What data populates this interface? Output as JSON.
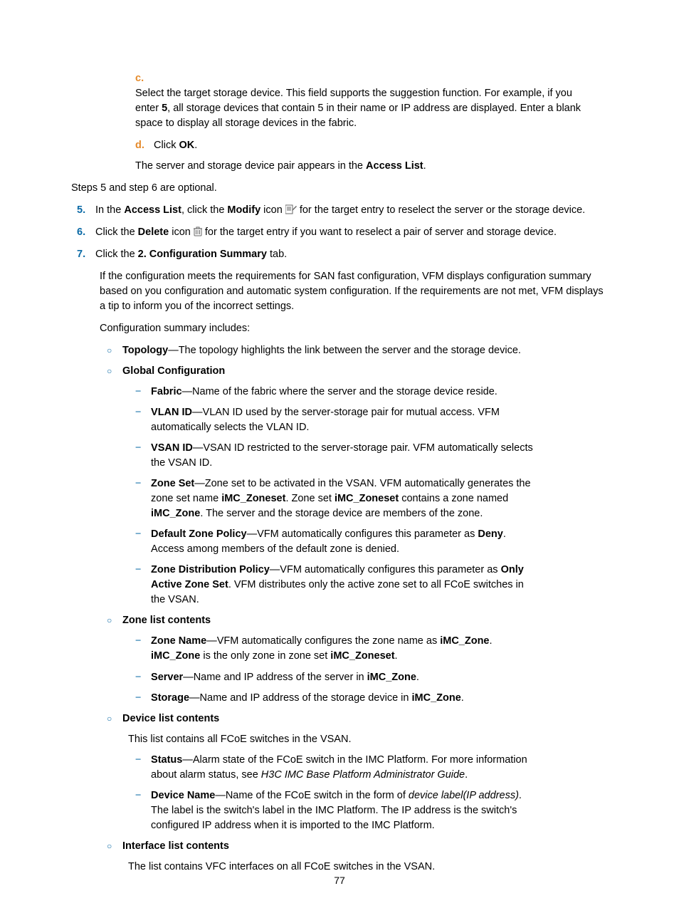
{
  "step_c_marker": "c.",
  "step_c_text_1": "Select the target storage device. This field supports the suggestion function. For example, if you enter ",
  "step_c_bold_5": "5",
  "step_c_text_2": ", all storage devices that contain 5 in their name or IP address are displayed. Enter a blank space to display all storage devices in the fabric.",
  "step_d_marker": "d.",
  "step_d_text_1": "Click ",
  "step_d_bold_ok": "OK",
  "step_d_text_2": ".",
  "para_pair_1": "The server and storage device pair appears in the ",
  "para_pair_bold": "Access List",
  "para_pair_2": ".",
  "para_steps_optional": "Steps 5 and step 6 are optional.",
  "step_5_marker": "5.",
  "step_5_text_1": "In the ",
  "step_5_bold_al": "Access List",
  "step_5_text_2": ", click the ",
  "step_5_bold_mod": "Modify",
  "step_5_text_3": " icon ",
  "step_5_text_4": " for the target entry to reselect the server or the storage device.",
  "step_6_marker": "6.",
  "step_6_text_1": "Click the ",
  "step_6_bold_del": "Delete",
  "step_6_text_2": " icon ",
  "step_6_text_3": " for the target entry if you want to reselect a pair of server and storage device.",
  "step_7_marker": "7.",
  "step_7_text_1": "Click the ",
  "step_7_bold_cs": "2. Configuration Summary",
  "step_7_text_2": " tab.",
  "para_req": "If the configuration meets the requirements for SAN fast configuration, VFM displays configuration summary based on you configuration and automatic system configuration. If the requirements are not met, VFM displays a tip to inform you of the incorrect settings.",
  "para_includes": "Configuration summary includes:",
  "bullet_topo_bold": "Topology",
  "bullet_topo_text": "—The topology highlights the link between the server and the storage device.",
  "bullet_global_bold": "Global Configuration",
  "dash_fabric_bold": "Fabric",
  "dash_fabric_text": "—Name of the fabric where the server and the storage device reside.",
  "dash_vlan_bold": "VLAN ID",
  "dash_vlan_text": "—VLAN ID used by the server-storage pair for mutual access. VFM automatically selects the VLAN ID.",
  "dash_vsan_bold": "VSAN ID",
  "dash_vsan_text": "—VSAN ID restricted to the server-storage pair. VFM automatically selects the VSAN ID.",
  "dash_zoneset_bold": "Zone Set",
  "dash_zoneset_t1": "—Zone set to be activated in the VSAN. VFM automatically generates the zone set name ",
  "dash_zoneset_b1": "iMC_Zoneset",
  "dash_zoneset_t2": ". Zone set ",
  "dash_zoneset_b2": "iMC_Zoneset",
  "dash_zoneset_t3": " contains a zone named ",
  "dash_zoneset_b3": "iMC_Zone",
  "dash_zoneset_t4": ". The server and the storage device are members of the zone.",
  "dash_dzp_bold": "Default Zone Policy",
  "dash_dzp_t1": "—VFM automatically configures this parameter as ",
  "dash_dzp_b1": "Deny",
  "dash_dzp_t2": ". Access among members of the default zone is denied.",
  "dash_zdp_bold": "Zone Distribution Policy",
  "dash_zdp_t1": "—VFM automatically configures this parameter as ",
  "dash_zdp_b1": "Only Active Zone Set",
  "dash_zdp_t2": ". VFM distributes only the active zone set to all FCoE switches in the VSAN.",
  "bullet_zlc_bold": "Zone list contents",
  "dash_zn_bold": "Zone Name",
  "dash_zn_t1": "—VFM automatically configures the zone name as ",
  "dash_zn_b1": "iMC_Zone",
  "dash_zn_t2": ". ",
  "dash_zn_b2": "iMC_Zone",
  "dash_zn_t3": " is the only zone in zone set ",
  "dash_zn_b3": "iMC_Zoneset",
  "dash_zn_t4": ".",
  "dash_srv_bold": "Server",
  "dash_srv_t1": "—Name and IP address of the server in ",
  "dash_srv_b1": "iMC_Zone",
  "dash_srv_t2": ".",
  "dash_stg_bold": "Storage",
  "dash_stg_t1": "—Name and IP address of the storage device in ",
  "dash_stg_b1": "iMC_Zone",
  "dash_stg_t2": ".",
  "bullet_dlc_bold": "Device list contents",
  "para_dlc": "This list contains all FCoE switches in the VSAN.",
  "dash_status_bold": "Status",
  "dash_status_t1": "—Alarm state of the FCoE switch in the IMC Platform. For more information about alarm status, see ",
  "dash_status_i1": "H3C IMC Base Platform Administrator Guide",
  "dash_status_t2": ".",
  "dash_dn_bold": "Device Name",
  "dash_dn_t1": "—Name of the FCoE switch in the form of ",
  "dash_dn_i1": "device label(IP address)",
  "dash_dn_t2": ". The label is the switch's label in the IMC Platform. The IP address is the switch's configured IP address when it is imported to the IMC Platform.",
  "bullet_ilc_bold": "Interface list contents",
  "para_ilc": "The list contains VFC interfaces on all FCoE switches in the VSAN.",
  "page_number": "77"
}
